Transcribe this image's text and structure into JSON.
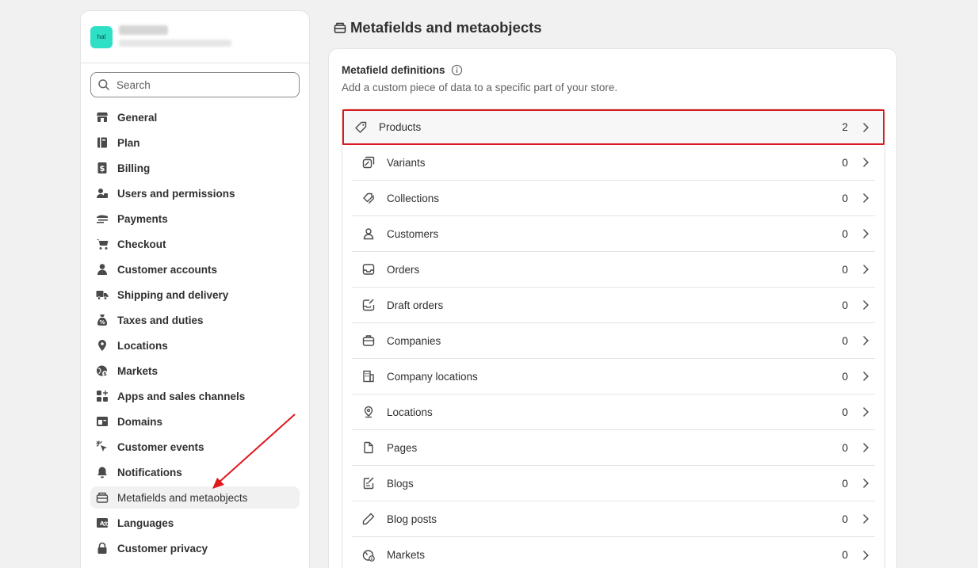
{
  "store": {
    "avatar_text": "hal"
  },
  "search": {
    "placeholder": "Search"
  },
  "nav": [
    {
      "label": "General",
      "icon": "store-icon"
    },
    {
      "label": "Plan",
      "icon": "plan-icon"
    },
    {
      "label": "Billing",
      "icon": "billing-icon"
    },
    {
      "label": "Users and permissions",
      "icon": "users-icon"
    },
    {
      "label": "Payments",
      "icon": "payments-icon"
    },
    {
      "label": "Checkout",
      "icon": "cart-icon"
    },
    {
      "label": "Customer accounts",
      "icon": "person-icon"
    },
    {
      "label": "Shipping and delivery",
      "icon": "truck-icon"
    },
    {
      "label": "Taxes and duties",
      "icon": "tax-icon"
    },
    {
      "label": "Locations",
      "icon": "location-icon"
    },
    {
      "label": "Markets",
      "icon": "globe-icon"
    },
    {
      "label": "Apps and sales channels",
      "icon": "apps-icon"
    },
    {
      "label": "Domains",
      "icon": "domains-icon"
    },
    {
      "label": "Customer events",
      "icon": "cursor-icon"
    },
    {
      "label": "Notifications",
      "icon": "bell-icon"
    },
    {
      "label": "Metafields and metaobjects",
      "icon": "metafields-icon",
      "active": true
    },
    {
      "label": "Languages",
      "icon": "languages-icon"
    },
    {
      "label": "Customer privacy",
      "icon": "lock-icon"
    }
  ],
  "page": {
    "title": "Metafields and metaobjects"
  },
  "card": {
    "title": "Metafield definitions",
    "subtitle": "Add a custom piece of data to a specific part of your store."
  },
  "definitions": [
    {
      "label": "Products",
      "count": "2",
      "icon": "tag-icon"
    },
    {
      "label": "Variants",
      "count": "0",
      "icon": "variants-icon"
    },
    {
      "label": "Collections",
      "count": "0",
      "icon": "collections-icon"
    },
    {
      "label": "Customers",
      "count": "0",
      "icon": "person-icon"
    },
    {
      "label": "Orders",
      "count": "0",
      "icon": "inbox-icon"
    },
    {
      "label": "Draft orders",
      "count": "0",
      "icon": "draft-order-icon"
    },
    {
      "label": "Companies",
      "count": "0",
      "icon": "companies-icon"
    },
    {
      "label": "Company locations",
      "count": "0",
      "icon": "building-icon"
    },
    {
      "label": "Locations",
      "count": "0",
      "icon": "location-icon"
    },
    {
      "label": "Pages",
      "count": "0",
      "icon": "page-icon"
    },
    {
      "label": "Blogs",
      "count": "0",
      "icon": "blog-icon"
    },
    {
      "label": "Blog posts",
      "count": "0",
      "icon": "pencil-icon"
    },
    {
      "label": "Markets",
      "count": "0",
      "icon": "globe-icon"
    }
  ],
  "colors": {
    "highlight_border": "#d8191f",
    "annotation_arrow": "#e0181e",
    "avatar_bg": "#2fe0c6"
  }
}
